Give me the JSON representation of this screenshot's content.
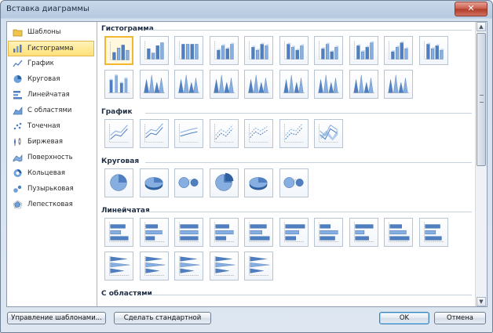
{
  "window": {
    "title": "Вставка диаграммы",
    "close_glyph": "✕"
  },
  "sidebar": {
    "items": [
      {
        "label": "Шаблоны",
        "icon": "folder-icon",
        "selected": false
      },
      {
        "label": "Гистограмма",
        "icon": "column-chart-icon",
        "selected": true
      },
      {
        "label": "График",
        "icon": "line-chart-icon",
        "selected": false
      },
      {
        "label": "Круговая",
        "icon": "pie-chart-icon",
        "selected": false
      },
      {
        "label": "Линейчатая",
        "icon": "bar-chart-icon",
        "selected": false
      },
      {
        "label": "С областями",
        "icon": "area-chart-icon",
        "selected": false
      },
      {
        "label": "Точечная",
        "icon": "scatter-chart-icon",
        "selected": false
      },
      {
        "label": "Биржевая",
        "icon": "stock-chart-icon",
        "selected": false
      },
      {
        "label": "Поверхность",
        "icon": "surface-chart-icon",
        "selected": false
      },
      {
        "label": "Кольцевая",
        "icon": "doughnut-chart-icon",
        "selected": false
      },
      {
        "label": "Пузырьковая",
        "icon": "bubble-chart-icon",
        "selected": false
      },
      {
        "label": "Лепестковая",
        "icon": "radar-chart-icon",
        "selected": false
      }
    ]
  },
  "gallery": {
    "sections": [
      {
        "title": "Гистограмма",
        "count": 19,
        "kind": "column"
      },
      {
        "title": "График",
        "count": 7,
        "kind": "line"
      },
      {
        "title": "Круговая",
        "count": 6,
        "kind": "pie"
      },
      {
        "title": "Линейчатая",
        "count": 15,
        "kind": "bar"
      },
      {
        "title": "С областями",
        "count": 0,
        "kind": "area"
      }
    ],
    "selected_section": 0,
    "selected_index": 0
  },
  "scrollbar": {
    "up": "▲",
    "down": "▼"
  },
  "buttons": {
    "manage_templates": "Управление шаблонами...",
    "set_default": "Сделать стандартной",
    "ok": "OK",
    "cancel": "Отмена"
  },
  "colors": {
    "accent_blue": "#4f7fc0",
    "selection_gold": "#f2b631"
  }
}
